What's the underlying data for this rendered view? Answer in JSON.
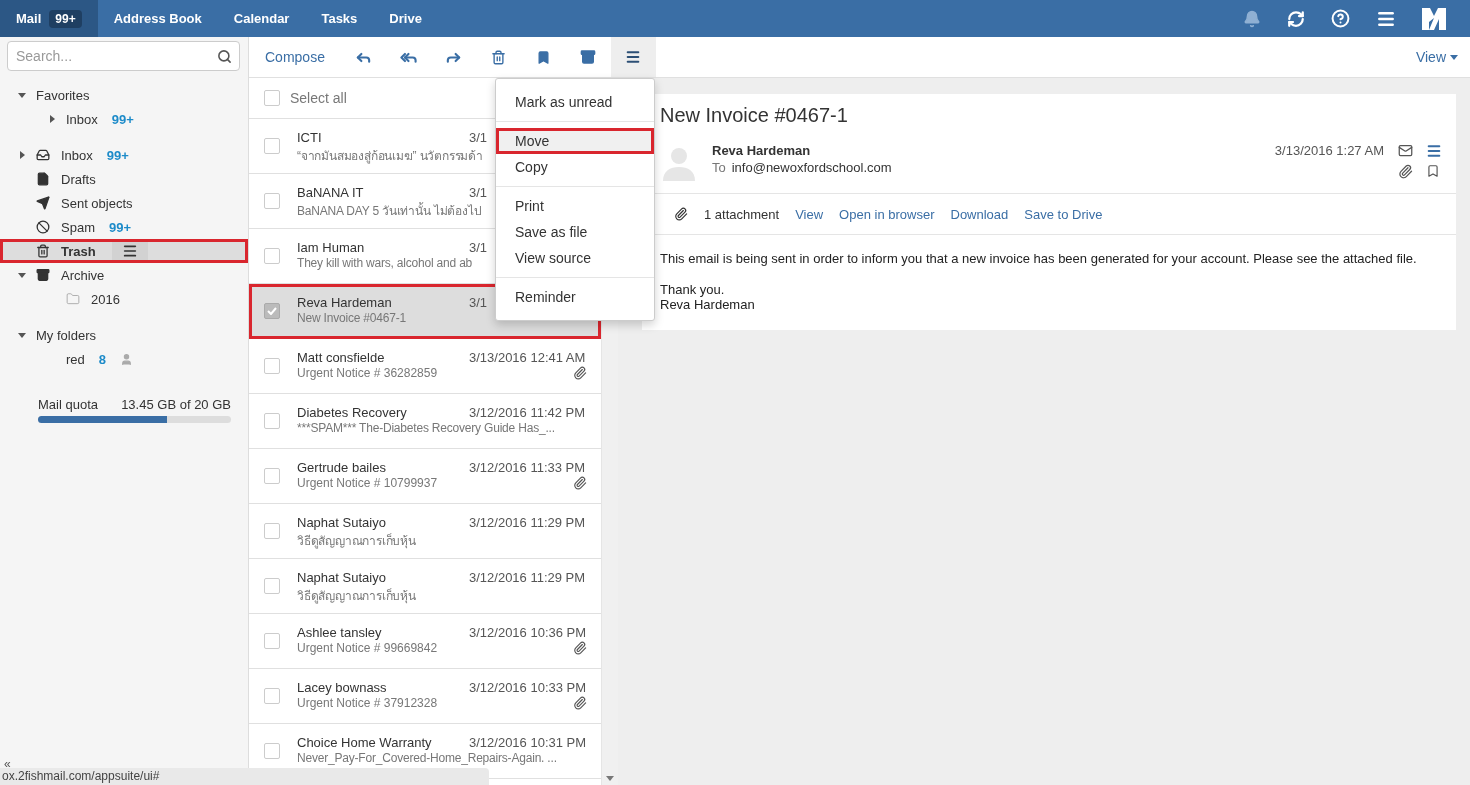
{
  "topbar": {
    "apps": [
      {
        "label": "Mail",
        "badge": "99+",
        "selected": true
      },
      {
        "label": "Address Book",
        "selected": false
      },
      {
        "label": "Calendar",
        "selected": false
      },
      {
        "label": "Tasks",
        "selected": false
      },
      {
        "label": "Drive",
        "selected": false
      }
    ],
    "notifications_disabled": true
  },
  "search": {
    "placeholder": "Search..."
  },
  "sidebar": {
    "groups": [
      {
        "items": [
          {
            "label": "Favorites",
            "kind": "none",
            "expanded": true,
            "children": [
              {
                "label": "Inbox",
                "kind": "none",
                "count": "99+",
                "expanded": false,
                "selected": false,
                "highlighted": false
              }
            ]
          }
        ]
      },
      {
        "items": [
          {
            "label": "Inbox",
            "kind": "inbox",
            "count": "99+",
            "expanded": false,
            "selected": false,
            "highlighted": false
          },
          {
            "label": "Drafts",
            "kind": "drafts",
            "selected": false,
            "highlighted": false
          },
          {
            "label": "Sent objects",
            "kind": "sent",
            "selected": false,
            "highlighted": false
          },
          {
            "label": "Spam",
            "kind": "spam",
            "count": "99+",
            "selected": false,
            "highlighted": false
          },
          {
            "label": "Trash",
            "kind": "trash",
            "selected": true,
            "highlighted": true
          },
          {
            "label": "Archive",
            "kind": "archive",
            "expanded": true,
            "selected": false,
            "highlighted": false,
            "children": [
              {
                "label": "2016",
                "kind": "folder",
                "selected": false,
                "highlighted": false
              }
            ]
          }
        ]
      },
      {
        "items": [
          {
            "label": "My folders",
            "kind": "none",
            "expanded": true,
            "children": [
              {
                "label": "red",
                "kind": "none",
                "count": "8",
                "shared": true,
                "selected": false,
                "highlighted": false
              }
            ]
          }
        ]
      }
    ],
    "quota": {
      "label": "Mail quota",
      "value": "13.45 GB of 20 GB",
      "level": 0.67
    },
    "collapse": "«"
  },
  "toolbar": {
    "compose": "Compose",
    "more_open": true,
    "view": "View"
  },
  "list": {
    "select_all": {
      "label": "Select all",
      "checked": false
    },
    "messages": [
      {
        "from": "ICTI",
        "date": "3/1",
        "subject": "“จากมันสมองสู่ก้อนเมฆ” นวัตกรรมด้า",
        "attachment": false,
        "checked": false,
        "selected": false,
        "highlighted": false
      },
      {
        "from": "BaNANA IT",
        "date": "3/1",
        "subject": "BaNANA DAY 5 วันเท่านั้น ไม่ต้องไป",
        "attachment": false,
        "checked": false,
        "selected": false,
        "highlighted": false
      },
      {
        "from": "Iam Human",
        "date": "3/1",
        "subject": "They kill with wars, alcohol and ab",
        "attachment": false,
        "checked": false,
        "selected": false,
        "highlighted": false
      },
      {
        "from": "Reva Hardeman",
        "date": "3/1",
        "subject": "New Invoice #0467-1",
        "attachment": false,
        "checked": true,
        "selected": true,
        "highlighted": true
      },
      {
        "from": "Matt consfielde",
        "date": "3/13/2016 12:41 AM",
        "subject": "Urgent Notice # 36282859",
        "attachment": true,
        "checked": false,
        "selected": false,
        "highlighted": false
      },
      {
        "from": "Diabetes Recovery",
        "date": "3/12/2016 11:42 PM",
        "subject": "***SPAM*** The-Diabetes Recovery Guide Has_...",
        "attachment": false,
        "checked": false,
        "selected": false,
        "highlighted": false
      },
      {
        "from": "Gertrude bailes",
        "date": "3/12/2016 11:33 PM",
        "subject": "Urgent Notice # 10799937",
        "attachment": true,
        "checked": false,
        "selected": false,
        "highlighted": false
      },
      {
        "from": "Naphat Sutaiyo",
        "date": "3/12/2016 11:29 PM",
        "subject": "วิธีดูสัญญาณการเก็บหุ้น",
        "attachment": false,
        "checked": false,
        "selected": false,
        "highlighted": false
      },
      {
        "from": "Naphat Sutaiyo",
        "date": "3/12/2016 11:29 PM",
        "subject": "วิธีดูสัญญาณการเก็บหุ้น",
        "attachment": false,
        "checked": false,
        "selected": false,
        "highlighted": false
      },
      {
        "from": "Ashlee tansley",
        "date": "3/12/2016 10:36 PM",
        "subject": "Urgent Notice # 99669842",
        "attachment": true,
        "checked": false,
        "selected": false,
        "highlighted": false
      },
      {
        "from": "Lacey bownass",
        "date": "3/12/2016 10:33 PM",
        "subject": "Urgent Notice # 37912328",
        "attachment": true,
        "checked": false,
        "selected": false,
        "highlighted": false
      },
      {
        "from": "Choice Home Warranty",
        "date": "3/12/2016 10:31 PM",
        "subject": "Never_Pay-For_Covered-Home_Repairs-Again. ...",
        "attachment": false,
        "checked": false,
        "selected": false,
        "highlighted": false
      }
    ]
  },
  "menu": {
    "groups": [
      {
        "items": [
          {
            "label": "Mark as unread",
            "highlighted": false
          }
        ]
      },
      {
        "items": [
          {
            "label": "Move",
            "highlighted": true
          },
          {
            "label": "Copy",
            "highlighted": false
          }
        ]
      },
      {
        "items": [
          {
            "label": "Print",
            "highlighted": false
          },
          {
            "label": "Save as file",
            "highlighted": false
          },
          {
            "label": "View source",
            "highlighted": false
          }
        ]
      },
      {
        "items": [
          {
            "label": "Reminder",
            "highlighted": false
          }
        ]
      }
    ]
  },
  "reader": {
    "title": "New Invoice #0467-1",
    "from": "Reva Hardeman",
    "to_label": "To",
    "to": "info@newoxfordschool.com",
    "date": "3/13/2016 1:27 AM",
    "attachments": {
      "count": "1 attachment",
      "actions": [
        "View",
        "Open in browser",
        "Download",
        "Save to Drive"
      ]
    },
    "body": [
      [
        "This email is being sent in order to inform you that a new invoice has been generated for your account. Please see the attached file."
      ],
      [
        "Thank you.",
        "Reva Hardeman"
      ]
    ]
  },
  "status_bar": "ox.2fishmail.com/appsuite/ui#"
}
